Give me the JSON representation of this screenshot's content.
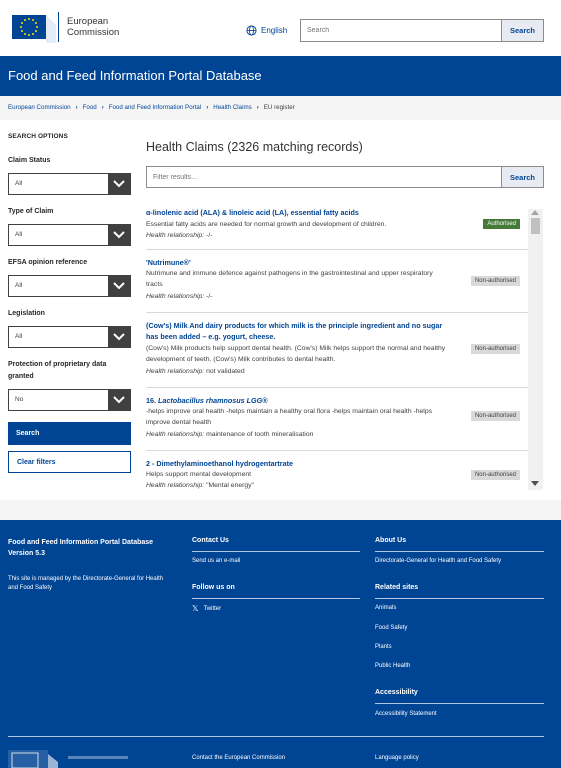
{
  "header": {
    "logo_line1": "European",
    "logo_line2": "Commission",
    "language": "English",
    "search_placeholder": "Search",
    "search_button": "Search"
  },
  "title": "Food and Feed Information Portal Database",
  "breadcrumb": [
    "European Commission",
    "Food",
    "Food and Feed Information Portal",
    "Health Claims",
    "EU register"
  ],
  "sidebar": {
    "heading": "SEARCH OPTIONS",
    "filters": [
      {
        "label": "Claim Status",
        "value": "All"
      },
      {
        "label": "Type of Claim",
        "value": "All"
      },
      {
        "label": "EFSA opinion reference",
        "value": "All"
      },
      {
        "label": "Legislation",
        "value": "All"
      },
      {
        "label": "Protection of proprietary data granted",
        "value": "No"
      }
    ],
    "search_button": "Search",
    "clear_button": "Clear filters"
  },
  "results": {
    "title": "Health Claims (2326 matching records)",
    "filter_placeholder": "Filter results...",
    "filter_button": "Search",
    "relationship_label": "Health relationship:",
    "items": [
      {
        "title": "α-linolenic acid (ALA) & linoleic acid (LA), essential fatty acids",
        "desc": "Essential fatty acids are needed for normal growth and development of children.",
        "relationship": "-/-",
        "status": "Authorised"
      },
      {
        "title": "'Nutrimune®'",
        "desc": "Nutrimune and immune defence against pathogens in the gastrointestinal and upper respiratory tracts",
        "relationship": "-/-",
        "status": "Non-authorised"
      },
      {
        "title": "(Cow's) Milk And dairy products for which milk is the principle ingredient and no sugar has been added – e.g. yogurt, cheese.",
        "desc": "(Cow's) Milk products help support dental health. (Cow's) Milk helps support the normal and healthy development of teeth. (Cow's) Milk contributes to dental health.",
        "relationship": "not validated",
        "status": "Non-authorised"
      },
      {
        "title_prefix": "16. ",
        "title": "Lactobacillus rhamnosus LGG®",
        "desc": "-helps improve oral health -helps maintain a healthy oral flora -helps maintain oral health -helps improve dental health",
        "relationship": "maintenance of tooth mineralisation",
        "status": "Non-authorised"
      },
      {
        "title": "2 - Dimethylaminoethanol hydrogentartrate",
        "desc": "Helps support mental development",
        "relationship": "\"Mental energy\"",
        "status": "Non-authorised"
      }
    ]
  },
  "footer": {
    "site_name": "Food and Feed Information Portal Database",
    "version": "Version 5.3",
    "managed_by": "This site is managed by the Directorate-General for Health and Food Safety",
    "contact_heading": "Contact Us",
    "contact_link": "Send us an e-mail",
    "follow_heading": "Follow us on",
    "twitter": "Twitter",
    "about_heading": "About Us",
    "about_link": "Directorate-General for Health and Food Safety",
    "related_heading": "Related sites",
    "related_links": [
      "Animals",
      "Food Safety",
      "Plants",
      "Public Health"
    ],
    "accessibility_heading": "Accessibility",
    "accessibility_link": "Accessibility Statement",
    "bottom_left_link": "Contact the European Commission",
    "bottom_right_link": "Language policy"
  },
  "colors": {
    "brand_blue": "#004494",
    "authorised_green": "#467a39",
    "badge_grey": "#d9d9d9"
  },
  "icons": [
    "eu-flag-icon",
    "globe-icon",
    "chevron-down-icon",
    "twitter-x-icon",
    "breadcrumb-chevron-icon"
  ]
}
